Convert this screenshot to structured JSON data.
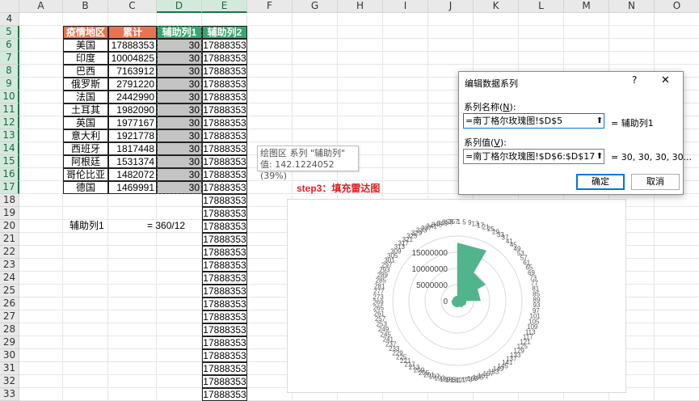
{
  "spreadsheet": {
    "columns": [
      "A",
      "B",
      "C",
      "D",
      "E",
      "F",
      "G",
      "H",
      "I",
      "J",
      "K",
      "L",
      "M",
      "N",
      "O"
    ],
    "selected_columns": [
      "D",
      "E"
    ],
    "rows": [
      "4",
      "5",
      "6",
      "7",
      "8",
      "9",
      "10",
      "11",
      "12",
      "13",
      "14",
      "15",
      "16",
      "17",
      "18",
      "19",
      "20",
      "21",
      "22",
      "23",
      "24",
      "25",
      "26",
      "27",
      "28",
      "29",
      "30",
      "31",
      "32",
      "33"
    ],
    "selected_rows": [
      "5",
      "6",
      "7",
      "8",
      "9",
      "10",
      "11",
      "12",
      "13",
      "14",
      "15",
      "16",
      "17"
    ],
    "table_headers": {
      "region": "疫情地区",
      "total": "累计",
      "aux1": "辅助列1",
      "aux2": "辅助列2"
    },
    "table_rows": [
      {
        "region": "美国",
        "total": "17888353",
        "aux1": "30"
      },
      {
        "region": "印度",
        "total": "10004825",
        "aux1": "30"
      },
      {
        "region": "巴西",
        "total": "7163912",
        "aux1": "30"
      },
      {
        "region": "俄罗斯",
        "total": "2791220",
        "aux1": "30"
      },
      {
        "region": "法国",
        "total": "2442990",
        "aux1": "30"
      },
      {
        "region": "土耳其",
        "total": "1982090",
        "aux1": "30"
      },
      {
        "region": "英国",
        "total": "1977167",
        "aux1": "30"
      },
      {
        "region": "意大利",
        "total": "1921778",
        "aux1": "30"
      },
      {
        "region": "西班牙",
        "total": "1817448",
        "aux1": "30"
      },
      {
        "region": "阿根廷",
        "total": "1531374",
        "aux1": "30"
      },
      {
        "region": "哥伦比亚",
        "total": "1482072",
        "aux1": "30"
      },
      {
        "region": "德国",
        "total": "1469991",
        "aux1": "30"
      }
    ],
    "aux2_value": "17888353",
    "note_label": "辅助列1",
    "note_formula": "= 360/12"
  },
  "step_label": "step3：填充雷达图",
  "tooltip": {
    "line1": "绘图区 系列 \"辅助列\"",
    "line2": "值: 142.1224052 (39%)"
  },
  "chart_data": {
    "type": "radar",
    "r_ticks": [
      "0",
      "5000000",
      "10000000",
      "15000000"
    ],
    "angle_labels_visible": [
      "1",
      "5",
      "9",
      "13",
      "17",
      "21",
      "25",
      "29",
      "33",
      "37",
      "41",
      "45",
      "49",
      "53",
      "57",
      "61",
      "65",
      "69",
      "73",
      "77",
      "81",
      "85",
      "89",
      "93",
      "97",
      "101",
      "105",
      "109",
      "113",
      "117",
      "121",
      "125",
      "129",
      "133",
      "137",
      "141",
      "145",
      "149",
      "153",
      "157",
      "161",
      "165",
      "169",
      "173",
      "177",
      "181",
      "185",
      "189",
      "193",
      "197",
      "201",
      "205",
      "209",
      "213",
      "217",
      "221",
      "225",
      "229",
      "233",
      "237",
      "241",
      "245",
      "249",
      "253",
      "257",
      "261",
      "265",
      "269",
      "273",
      "277",
      "281",
      "285",
      "289",
      "293",
      "297",
      "301",
      "305",
      "309",
      "313",
      "317",
      "321",
      "325",
      "329",
      "333",
      "337",
      "341",
      "345",
      "349",
      "353",
      "357"
    ],
    "rmax": 20000000,
    "segments": [
      {
        "from_deg": 0,
        "to_deg": 30,
        "value": 17888353
      },
      {
        "from_deg": 30,
        "to_deg": 60,
        "value": 10004825
      },
      {
        "from_deg": 60,
        "to_deg": 90,
        "value": 7163912
      },
      {
        "from_deg": 90,
        "to_deg": 120,
        "value": 2791220
      },
      {
        "from_deg": 120,
        "to_deg": 150,
        "value": 2442990
      },
      {
        "from_deg": 150,
        "to_deg": 180,
        "value": 1982090
      },
      {
        "from_deg": 180,
        "to_deg": 210,
        "value": 1977167
      },
      {
        "from_deg": 210,
        "to_deg": 240,
        "value": 1921778
      },
      {
        "from_deg": 240,
        "to_deg": 270,
        "value": 1817448
      },
      {
        "from_deg": 270,
        "to_deg": 300,
        "value": 1531374
      },
      {
        "from_deg": 300,
        "to_deg": 330,
        "value": 1482072
      },
      {
        "from_deg": 330,
        "to_deg": 360,
        "value": 1469991
      }
    ],
    "fill_color": "#52b48c",
    "grid_color": "#d9d9d9"
  },
  "dialog": {
    "title": "编辑数据系列",
    "help": "?",
    "close": "✕",
    "name_label_pre": "系列名称(",
    "name_label_key": "N",
    "name_label_post": "):",
    "name_value": "=南丁格尔玫瑰图!$D$5",
    "name_preview": "= 辅助列1",
    "values_label_pre": "系列值(",
    "values_label_key": "V",
    "values_label_post": "):",
    "values_value": "=南丁格尔玫瑰图!$D$6:$D$17",
    "values_preview": "= 30, 30, 30, 30...",
    "collapse_glyph": "⬆",
    "ok": "确定",
    "cancel": "取消"
  }
}
